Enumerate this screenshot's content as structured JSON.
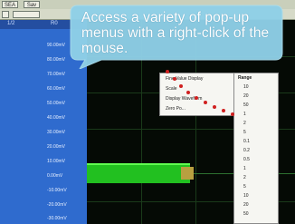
{
  "callout": {
    "text": "Access a variety of pop-up menus with a right-click of the mouse."
  },
  "toolbar": {
    "buttons": [
      "SEA",
      "Sav"
    ]
  },
  "panel": {
    "header_left": "1/2",
    "header_right": "R0",
    "ticks": [
      "90.00mV",
      "80.00mV",
      "70.00mV",
      "60.00mV",
      "50.00mV",
      "40.00mV",
      "30.00mV",
      "20.00mV",
      "10.00mV",
      "0.00mV",
      "-10.00mV",
      "-20.00mV",
      "-30.00mV"
    ]
  },
  "context_menu": {
    "items": [
      "Fine Value Display",
      "Scale",
      "Display Waveform",
      "Zero Po..."
    ]
  },
  "submenu": {
    "header": "Range",
    "items": [
      "10",
      "20",
      "50",
      "1",
      "2",
      "5",
      "0.1",
      "0.2",
      "0.5",
      "1",
      "2",
      "5",
      "10",
      "20",
      "50"
    ]
  },
  "colors": {
    "panel": "#2f6bce",
    "scope_bg": "#050a05",
    "trace": "#22c020",
    "callout": "#8fd0e8",
    "pointer_dots": "#d02020"
  }
}
